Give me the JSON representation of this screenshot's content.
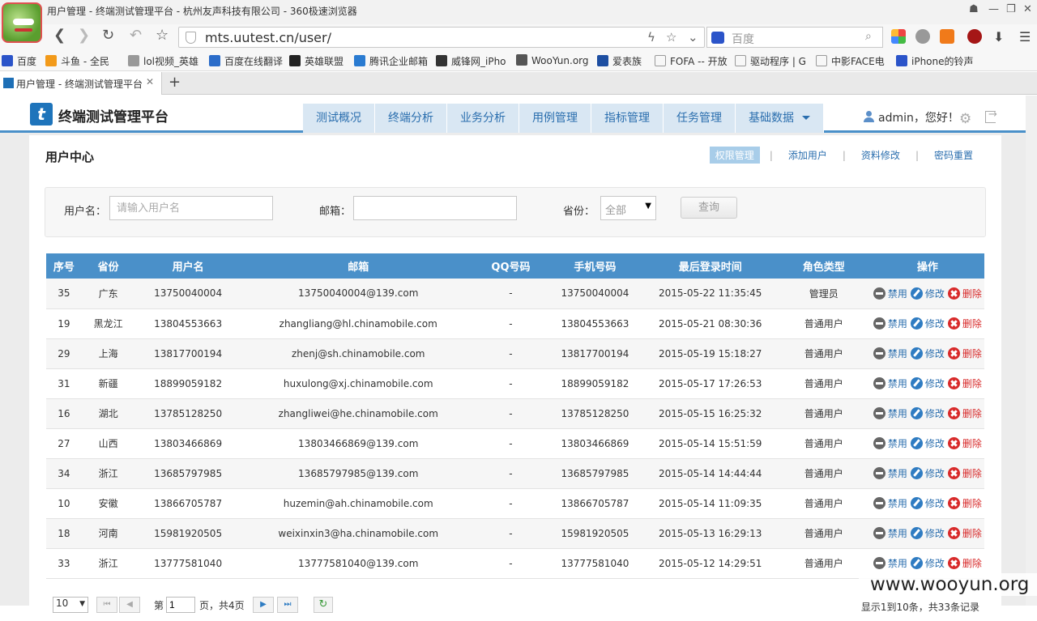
{
  "browser": {
    "window_title": "用户管理 - 终端测试管理平台 - 杭州友声科技有限公司 - 360极速浏览器",
    "url": "mts.uutest.cn/user/",
    "search_placeholder": "百度",
    "bookmarks": [
      "百度",
      "斗鱼 - 全民",
      "lol视频_英雄",
      "百度在线翻译",
      "英雄联盟",
      "腾讯企业邮箱",
      "威锋网_iPho",
      "WooYun.org",
      "爱表族",
      "FOFA -- 开放",
      "驱动程序 | G",
      "中影FACE电",
      "iPhone的铃声"
    ],
    "tab_label": "用户管理 - 终端测试管理平台"
  },
  "header": {
    "logo_letter": "t",
    "site_title": "终端测试管理平台",
    "menu": [
      "测试概况",
      "终端分析",
      "业务分析",
      "用例管理",
      "指标管理",
      "任务管理",
      "基础数据"
    ],
    "user_greeting": "admin，您好！"
  },
  "panel": {
    "title": "用户中心",
    "links": [
      "权限管理",
      "添加用户",
      "资料修改",
      "密码重置"
    ]
  },
  "filter": {
    "username_label": "用户名：",
    "username_placeholder": "请输入用户名",
    "email_label": "邮箱：",
    "email_value": "",
    "province_label": "省份：",
    "province_value": "全部",
    "query_button": "查询"
  },
  "table": {
    "columns": [
      "序号",
      "省份",
      "用户名",
      "邮箱",
      "QQ号码",
      "手机号码",
      "最后登录时间",
      "角色类型",
      "操作"
    ],
    "actions": {
      "ban": "禁用",
      "edit": "修改",
      "delete": "删除"
    },
    "rows": [
      [
        "35",
        "广东",
        "13750040004",
        "13750040004@139.com",
        "-",
        "13750040004",
        "2015-05-22 11:35:45",
        "管理员"
      ],
      [
        "19",
        "黑龙江",
        "13804553663",
        "zhangliang@hl.chinamobile.com",
        "-",
        "13804553663",
        "2015-05-21 08:30:36",
        "普通用户"
      ],
      [
        "29",
        "上海",
        "13817700194",
        "zhenj@sh.chinamobile.com",
        "-",
        "13817700194",
        "2015-05-19 15:18:27",
        "普通用户"
      ],
      [
        "31",
        "新疆",
        "18899059182",
        "huxulong@xj.chinamobile.com",
        "-",
        "18899059182",
        "2015-05-17 17:26:53",
        "普通用户"
      ],
      [
        "16",
        "湖北",
        "13785128250",
        "zhangliwei@he.chinamobile.com",
        "-",
        "13785128250",
        "2015-05-15 16:25:32",
        "普通用户"
      ],
      [
        "27",
        "山西",
        "13803466869",
        "13803466869@139.com",
        "-",
        "13803466869",
        "2015-05-14 15:51:59",
        "普通用户"
      ],
      [
        "34",
        "浙江",
        "13685797985",
        "13685797985@139.com",
        "-",
        "13685797985",
        "2015-05-14 14:44:44",
        "普通用户"
      ],
      [
        "10",
        "安徽",
        "13866705787",
        "huzemin@ah.chinamobile.com",
        "-",
        "13866705787",
        "2015-05-14 11:09:35",
        "普通用户"
      ],
      [
        "18",
        "河南",
        "15981920505",
        "weixinxin3@ha.chinamobile.com",
        "-",
        "15981920505",
        "2015-05-13 16:29:13",
        "普通用户"
      ],
      [
        "33",
        "浙江",
        "13777581040",
        "13777581040@139.com",
        "-",
        "13777581040",
        "2015-05-12 14:29:51",
        "普通用户"
      ]
    ]
  },
  "pager": {
    "page_size": "10",
    "page_prefix": "第",
    "current_page": "1",
    "page_suffix": "页，共4页",
    "summary": "显示1到10条，共33条记录"
  },
  "watermark": "www.wooyun.org"
}
